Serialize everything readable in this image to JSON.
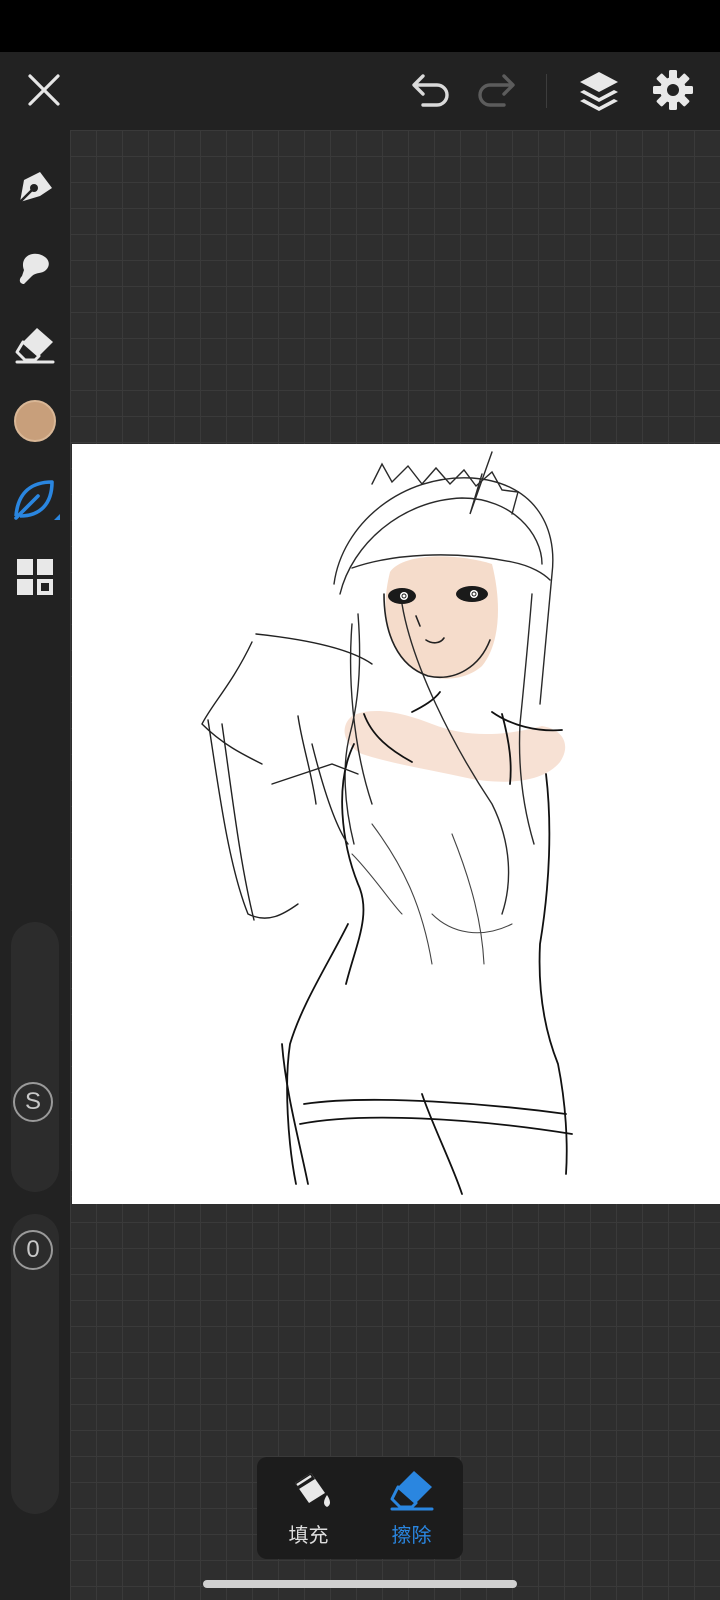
{
  "toolbar": {
    "close_icon": "close-icon",
    "undo_icon": "undo-icon",
    "redo_icon": "redo-icon",
    "layers_icon": "layers-icon",
    "settings_icon": "gear-icon"
  },
  "sidebar": {
    "tools": [
      {
        "name": "pen-tool",
        "icon": "pen-nib-icon"
      },
      {
        "name": "smudge-tool",
        "icon": "smudge-brush-icon"
      },
      {
        "name": "eraser-tool",
        "icon": "eraser-icon"
      },
      {
        "name": "color-picker",
        "icon": "color-swatch",
        "color": "#c89f7b"
      },
      {
        "name": "brush-library",
        "icon": "leaf-icon",
        "selected": true,
        "color": "#2a86e0"
      },
      {
        "name": "more-tools",
        "icon": "grid-icon"
      }
    ],
    "size_slider_label": "S",
    "opacity_slider_label": "0"
  },
  "mode_panel": {
    "fill_label": "填充",
    "erase_label": "擦除",
    "active": "erase",
    "accent_color": "#2a86e0"
  }
}
